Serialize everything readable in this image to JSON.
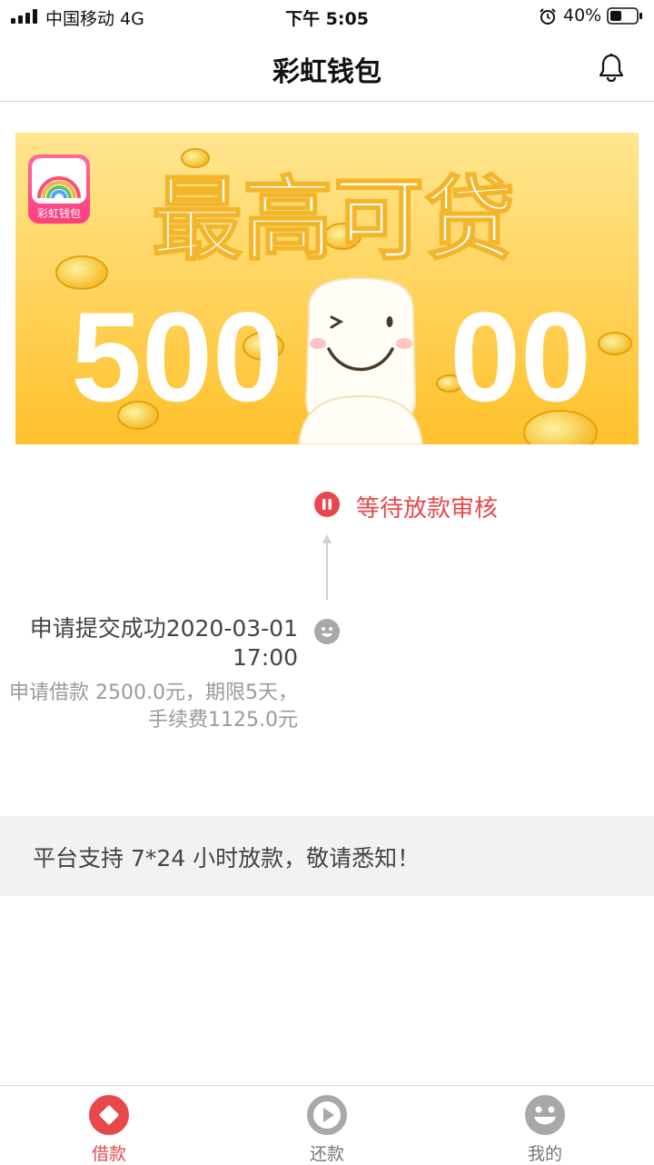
{
  "status_bar": {
    "carrier": "中国移动  4G",
    "time": "下午 5:05",
    "battery": "40%"
  },
  "nav": {
    "title": "彩虹钱包"
  },
  "banner": {
    "logo_text": "彩虹钱包",
    "headline": "最高可贷",
    "amount_left": "500",
    "amount_right": "00"
  },
  "timeline": {
    "current_status": "等待放款审核",
    "event_title": "申请提交成功2020-03-01 17:00",
    "event_desc": "申请借款 2500.0元，期限5天，手续费1125.0元"
  },
  "notice": {
    "text": "平台支持 7*24 小时放款，敬请悉知！"
  },
  "tabs": [
    {
      "label": "借款",
      "icon": "borrow-icon",
      "active": true
    },
    {
      "label": "还款",
      "icon": "play-icon",
      "active": false
    },
    {
      "label": "我的",
      "icon": "smile-icon",
      "active": false
    }
  ],
  "colors": {
    "accent": "#e8474b",
    "banner_top": "#ffe58a",
    "banner_bottom": "#ffc02a",
    "inactive": "#9a9a9a"
  }
}
